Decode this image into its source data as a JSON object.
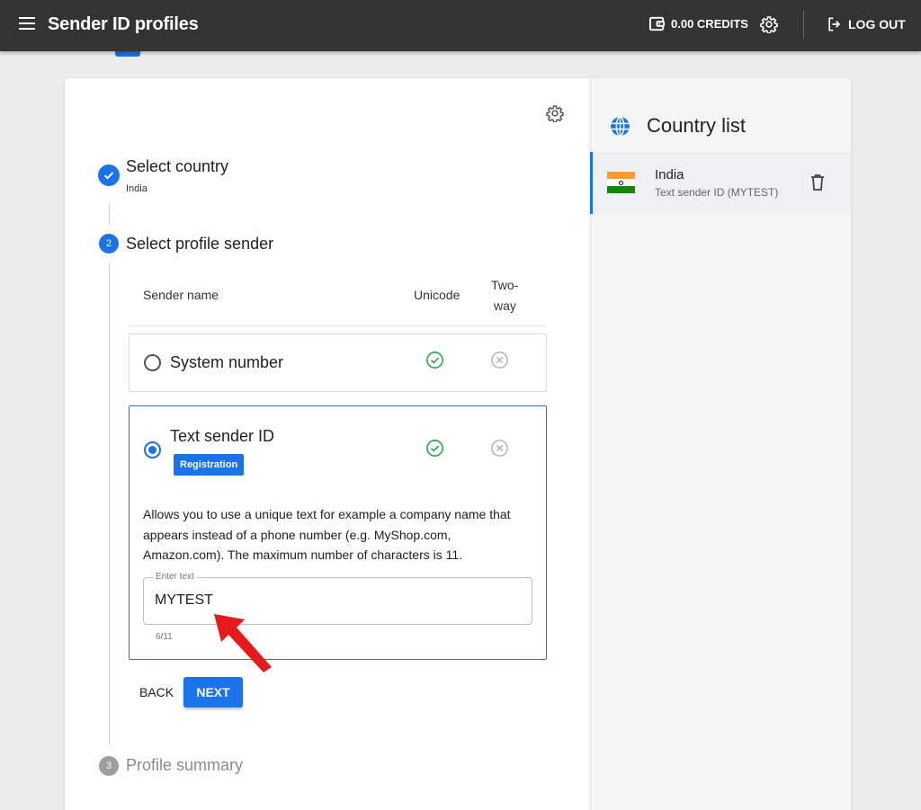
{
  "header": {
    "title": "Sender ID profiles",
    "credits": "0.00 CREDITS",
    "logout": "LOG OUT"
  },
  "steps": [
    {
      "title": "Select country",
      "subtitle": "India",
      "state": "done"
    },
    {
      "number": "2",
      "title": "Select profile sender",
      "state": "active"
    },
    {
      "number": "3",
      "title": "Profile summary",
      "state": "pending"
    }
  ],
  "table": {
    "col_sender": "Sender name",
    "col_unicode": "Unicode",
    "col_two_way_line1": "Two-",
    "col_two_way_line2": "way"
  },
  "options": [
    {
      "label": "System number",
      "selected": false,
      "unicode": true,
      "two_way": false
    },
    {
      "label": "Text sender ID",
      "selected": true,
      "badge": "Registration",
      "unicode": true,
      "two_way": false,
      "description": "Allows you to use a unique text for example a company name that appears instead of a phone number (e.g. MyShop.com, Amazon.com). The maximum number of characters is 11."
    }
  ],
  "text_field": {
    "label": "Enter text",
    "value": "MYTEST",
    "counter": "6/11"
  },
  "buttons": {
    "back": "BACK",
    "next": "NEXT"
  },
  "sidebar": {
    "title": "Country list",
    "countries": [
      {
        "name": "India",
        "detail": "Text sender ID (MYTEST)"
      }
    ]
  },
  "colors": {
    "accent": "#1a73e8",
    "success": "#34a853",
    "muted": "#b0b0b0",
    "annotation": "#e8191a",
    "topbar": "#333333"
  },
  "icons": [
    "menu-icon",
    "wallet-icon",
    "gear-icon",
    "logout-icon",
    "check-icon",
    "check-circle-icon",
    "x-circle-icon",
    "globe-icon",
    "trash-icon",
    "arrow-annotation"
  ]
}
